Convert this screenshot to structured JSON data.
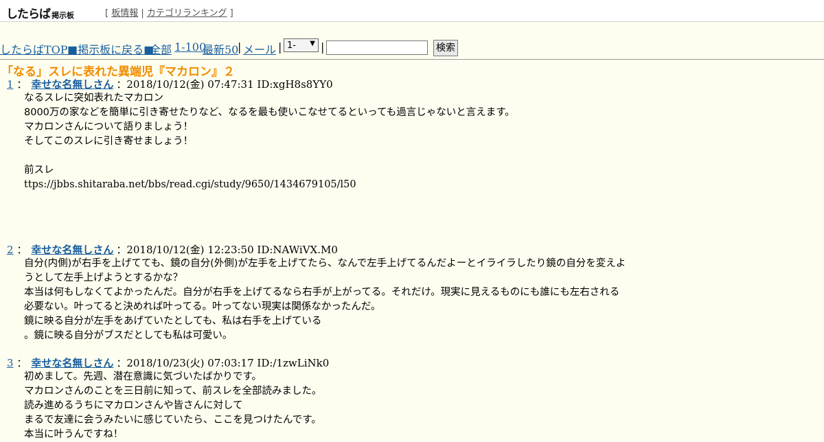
{
  "header": {
    "logo": "したらば",
    "logo_sub": "掲示板",
    "links": [
      "板情報",
      "カテゴリランキング"
    ]
  },
  "nav": {
    "top": "したらばTOP",
    "back": "■掲示板に戻る■",
    "all": "全部",
    "range": "1-100",
    "latest": "最新50",
    "mail": "メール",
    "select_value": "1-",
    "search_button": "検索"
  },
  "thread": {
    "title": "「なる」スレに表れた異端児『マカロン』２",
    "posts": [
      {
        "number": "1",
        "name": "幸せな名無しさん",
        "meta": "：2018/10/12(金) 07:47:31 ID:xgH8s8YY0",
        "lines": [
          "なるスレに突如表れたマカロン",
          "8000万の家などを簡単に引き寄せたりなど、なるを最も使いこなせてるといっても過言じゃないと言えます。",
          "マカロンさんについて語りましょう！",
          "そしてこのスレに引き寄せましょう！",
          "",
          "前スレ",
          "ttps://jbbs.shitaraba.net/bbs/read.cgi/study/9650/1434679105/l50"
        ]
      },
      {
        "number": "2",
        "name": "幸せな名無しさん",
        "meta": "：2018/10/12(金) 12:23:50 ID:NAWiVX.M0",
        "lines": [
          "自分(内側)が右手を上げてても、鏡の自分(外側)が左手を上げてたら、なんで左手上げてるんだよーとイライラしたり鏡の自分を変えよ",
          "うとして左手上げようとするかな？",
          "本当は何もしなくてよかったんだ。自分が右手を上げてるなら右手が上がってる。それだけ。現実に見えるものにも誰にも左右される",
          "必要ない。叶ってると決めれば叶ってる。叶ってない現実は関係なかったんだ。",
          "鏡に映る自分が左手をあげていたとしても、私は右手を上げている",
          "。鏡に映る自分がブスだとしても私は可愛い。"
        ]
      },
      {
        "number": "3",
        "name": "幸せな名無しさん",
        "meta": "：2018/10/23(火) 07:03:17 ID:/1zwLiNk0",
        "lines": [
          "初めまして。先週、潜在意識に気づいたばかりです。",
          "マカロンさんのことを三日前に知って、前スレを全部読みました。",
          "読み進めるうちにマカロンさんや皆さんに対して",
          "まるで友達に会うみたいに感じていたら、ここを見つけたんです。",
          "本当に叶うんですね！"
        ]
      }
    ]
  }
}
